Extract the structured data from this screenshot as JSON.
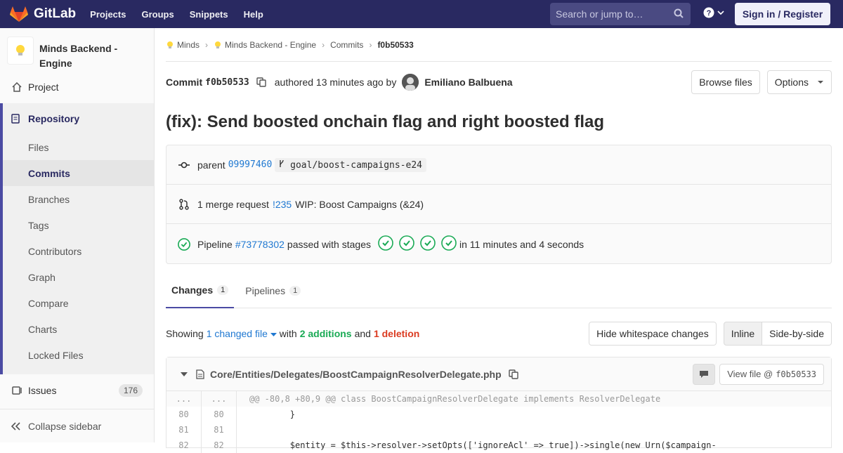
{
  "nav": {
    "brand": "GitLab",
    "links": [
      "Projects",
      "Groups",
      "Snippets",
      "Help"
    ],
    "search_placeholder": "Search or jump to…",
    "signin": "Sign in / Register"
  },
  "sidebar": {
    "project_name": "Minds Backend - Engine",
    "project": "Project",
    "repository": "Repository",
    "repo_items": [
      "Files",
      "Commits",
      "Branches",
      "Tags",
      "Contributors",
      "Graph",
      "Compare",
      "Charts",
      "Locked Files"
    ],
    "issues": "Issues",
    "issues_count": "176",
    "collapse": "Collapse sidebar"
  },
  "breadcrumb": [
    "Minds",
    "Minds Backend - Engine",
    "Commits",
    "f0b50533"
  ],
  "commit": {
    "label": "Commit",
    "sha": "f0b50533",
    "authored": "authored 13 minutes ago by",
    "author": "Emiliano Balbuena",
    "browse": "Browse files",
    "options": "Options",
    "title": "(fix): Send boosted onchain flag and right boosted flag",
    "parent_label": "parent",
    "parent_sha": "09997460",
    "branch": "goal/boost-campaigns-e24",
    "mr_label": "1 merge request",
    "mr_id": "!235",
    "mr_title": "WIP: Boost Campaigns (&24)",
    "pipeline_label": "Pipeline",
    "pipeline_id": "#73778302",
    "pipeline_status": "passed with stages",
    "pipeline_time": "in 11 minutes and 4 seconds"
  },
  "tabs": [
    {
      "label": "Changes",
      "count": "1"
    },
    {
      "label": "Pipelines",
      "count": "1"
    }
  ],
  "summary": {
    "showing": "Showing",
    "files": "1 changed file",
    "with": "with",
    "additions": "2 additions",
    "and": "and",
    "deletions": "1 deletion",
    "hide_ws": "Hide whitespace changes",
    "inline": "Inline",
    "side": "Side-by-side"
  },
  "diff": {
    "path": "Core/Entities/Delegates/BoostCampaignResolverDelegate.php",
    "view_file": "View file @",
    "view_sha": "f0b50533",
    "hunk": "@@ -80,8 +80,9 @@ class BoostCampaignResolverDelegate implements ResolverDelegate",
    "lines": [
      {
        "old": "80",
        "new": "80",
        "code": "        }"
      },
      {
        "old": "81",
        "new": "81",
        "code": ""
      },
      {
        "old": "82",
        "new": "82",
        "code": "        $entity = $this->resolver->setOpts(['ignoreAcl' => true])->single(new Urn($campaign-"
      }
    ]
  },
  "colors": {
    "navbar": "#292961",
    "accent": "#4b4ba3",
    "link": "#1f78d1",
    "success": "#1aaa55",
    "danger": "#db3b21"
  }
}
